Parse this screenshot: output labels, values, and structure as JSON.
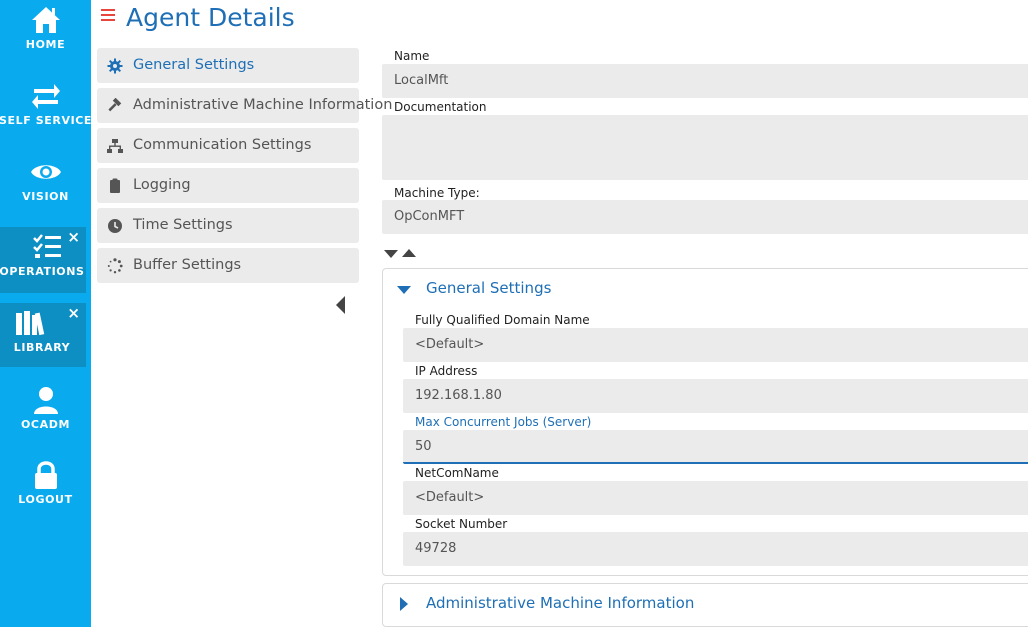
{
  "nav": {
    "items": [
      {
        "label": "HOME",
        "icon": "home-icon"
      },
      {
        "label": "SELF SERVICE",
        "icon": "swap-arrows-icon"
      },
      {
        "label": "VISION",
        "icon": "eye-icon"
      },
      {
        "label": "OPERATIONS",
        "icon": "checklist-icon"
      },
      {
        "label": "LIBRARY",
        "icon": "books-icon"
      },
      {
        "label": "OCADM",
        "icon": "user-icon"
      },
      {
        "label": "LOGOUT",
        "icon": "lock-icon"
      }
    ],
    "close_glyph": "×"
  },
  "header": {
    "title": "Agent Details"
  },
  "sections": [
    {
      "label": "General Settings",
      "icon": "gear-icon"
    },
    {
      "label": "Administrative Machine Information",
      "icon": "hammer-icon"
    },
    {
      "label": "Communication Settings",
      "icon": "network-icon"
    },
    {
      "label": "Logging",
      "icon": "clipboard-icon"
    },
    {
      "label": "Time Settings",
      "icon": "clock-icon"
    },
    {
      "label": "Buffer Settings",
      "icon": "spinner-icon"
    }
  ],
  "form": {
    "name_label": "Name",
    "name_value": "LocalMft",
    "documentation_label": "Documentation",
    "documentation_value": "",
    "machine_type_label": "Machine Type:",
    "machine_type_value": "OpConMFT"
  },
  "general_panel": {
    "title": "General Settings",
    "fqdn_label": "Fully Qualified Domain Name",
    "fqdn_value": "<Default>",
    "ip_label": "IP Address",
    "ip_value": "192.168.1.80",
    "max_jobs_label": "Max Concurrent Jobs (Server)",
    "max_jobs_value": "50",
    "netcom_label": "NetComName",
    "netcom_value": "<Default>",
    "socket_label": "Socket Number",
    "socket_value": "49728"
  },
  "admin_panel": {
    "title": "Administrative Machine Information"
  },
  "colors": {
    "nav_bg": "#0aabee",
    "nav_active": "#0d8fc4",
    "accent": "#1e6fb6",
    "menu_icon": "#e8463c",
    "field_bg": "#ebebeb"
  }
}
